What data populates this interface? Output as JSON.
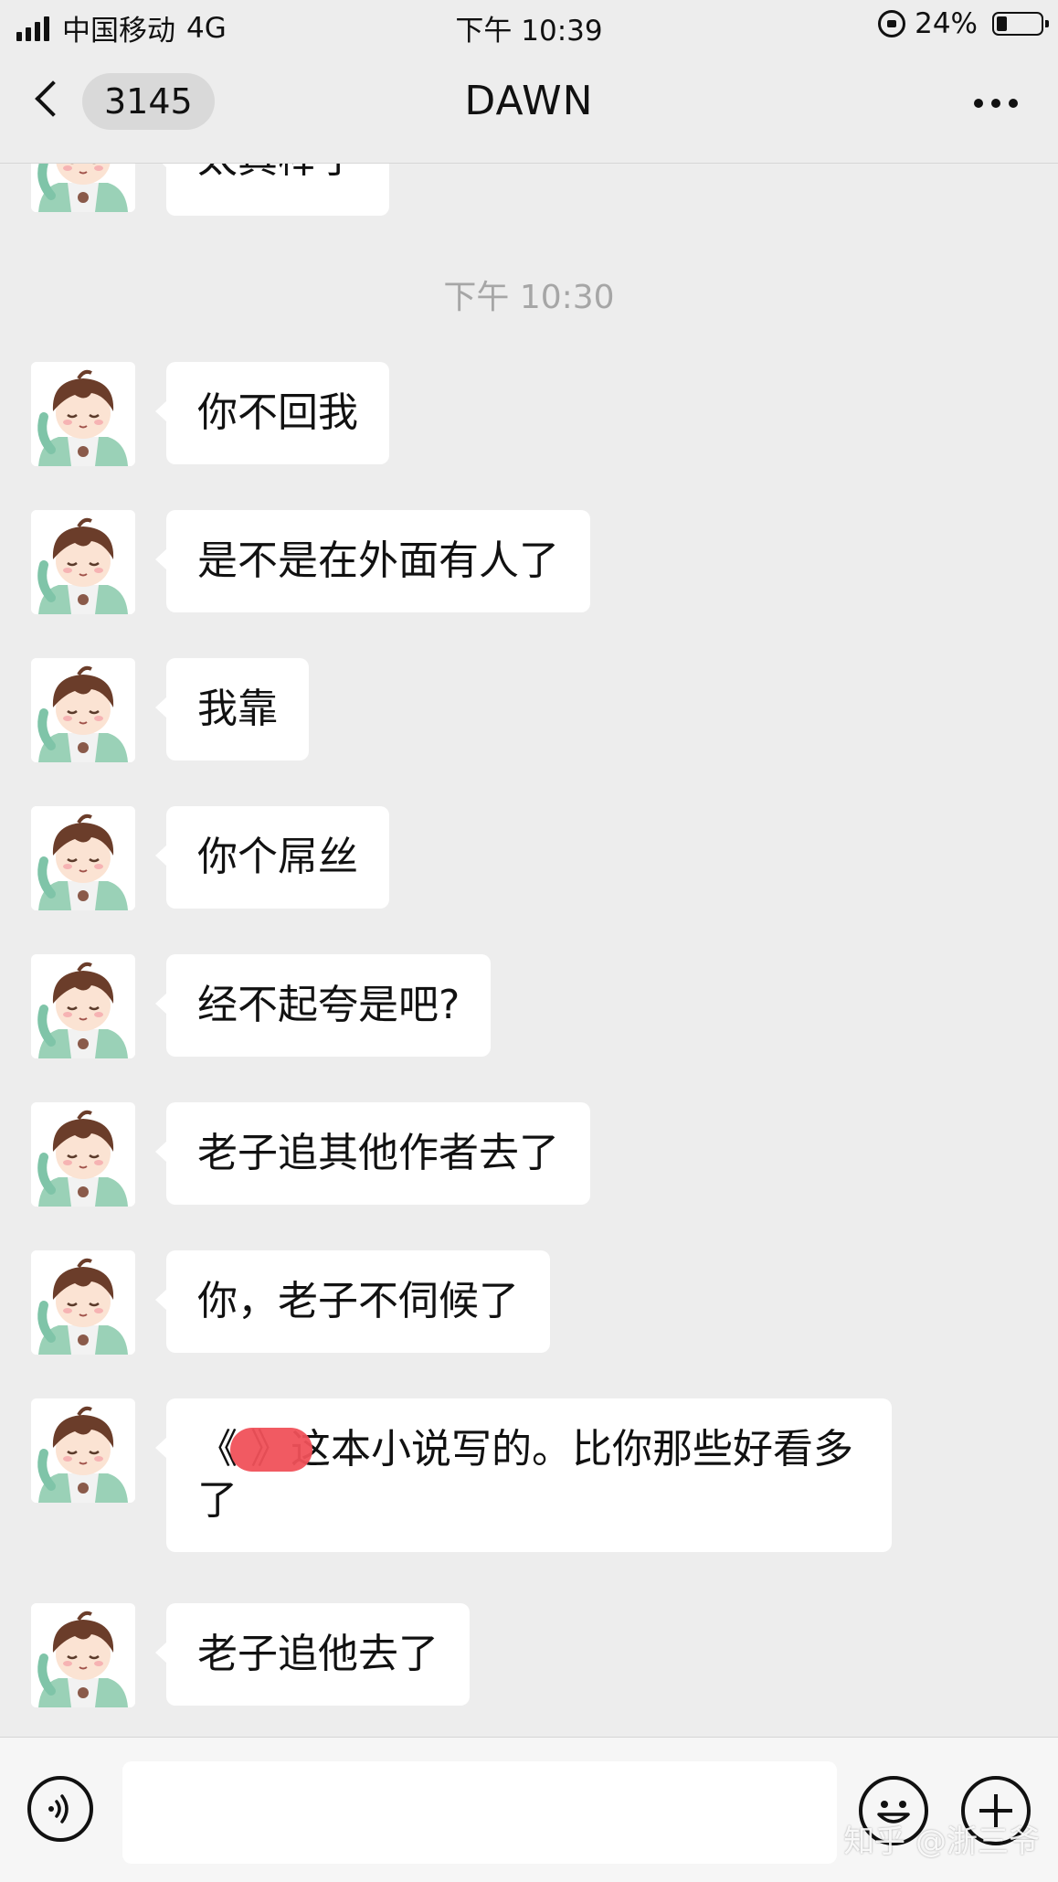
{
  "status_bar": {
    "carrier": "中国移动",
    "network": "4G",
    "time": "下午 10:39",
    "battery_percent_label": "24%",
    "battery_level": 0.24
  },
  "nav": {
    "unread_count": "3145",
    "title": "DAWN"
  },
  "chat": {
    "partial_top_message": "太真棒了",
    "timestamp": "下午 10:30",
    "messages": [
      {
        "text": "你不回我"
      },
      {
        "text": "是不是在外面有人了"
      },
      {
        "text": "我靠"
      },
      {
        "text": "你个屌丝"
      },
      {
        "text": "经不起夸是吧?"
      },
      {
        "text": "老子追其他作者去了"
      },
      {
        "text": "你，老子不伺候了"
      },
      {
        "text": "《    》这本小说写的。比你那些好看多了"
      },
      {
        "text": "老子追他去了"
      }
    ]
  },
  "input": {
    "value": ""
  },
  "watermark": "知乎 @浙三爷",
  "colors": {
    "background": "#ededed",
    "bubble": "#ffffff",
    "redaction": "#f0515a"
  }
}
